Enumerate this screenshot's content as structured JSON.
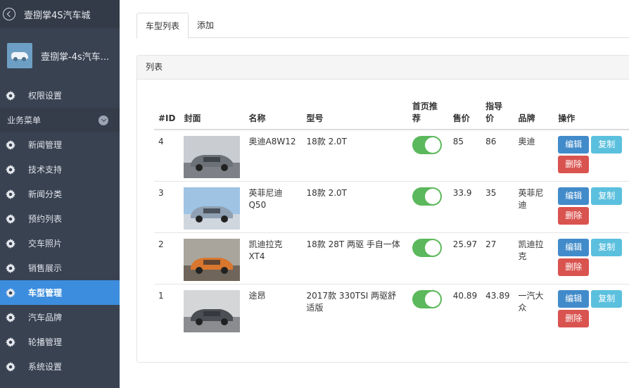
{
  "sidebar": {
    "title": "壹捌掌4S汽车城",
    "username": "壹捌掌-4s汽车...",
    "top_item": "权限设置",
    "group_label": "业务菜单",
    "items": [
      "新闻管理",
      "技术支持",
      "新闻分类",
      "预约列表",
      "交车照片",
      "销售展示",
      "车型管理",
      "汽车品牌",
      "轮播管理",
      "系统设置"
    ],
    "active_item": "车型管理"
  },
  "tabs": [
    "车型列表",
    "添加"
  ],
  "panel_title": "列表",
  "table": {
    "headers": [
      "#ID",
      "封面",
      "名称",
      "型号",
      "首页推荐",
      "售价",
      "指导价",
      "品牌",
      "操作"
    ],
    "rows": [
      {
        "id": "4",
        "name": "奥迪A8W12",
        "model": "18款 2.0T",
        "price": "85",
        "guide": "86",
        "brand": "奥迪"
      },
      {
        "id": "3",
        "name": "英菲尼迪Q50",
        "model": "18款 2.0T",
        "price": "33.9",
        "guide": "35",
        "brand": "英菲尼迪"
      },
      {
        "id": "2",
        "name": "凯迪拉克XT4",
        "model": "18款 28T 两驱 手自一体",
        "price": "25.97",
        "guide": "27",
        "brand": "凯迪拉克"
      },
      {
        "id": "1",
        "name": "途昂",
        "model": "2017款 330TSI 两驱舒适版",
        "price": "40.89",
        "guide": "43.89",
        "brand": "一汽大众"
      }
    ],
    "btn_edit": "编辑",
    "btn_copy": "复制",
    "btn_delete": "删除"
  },
  "colors": {
    "sidebar_bg": "#394251",
    "active": "#3c8dde",
    "toggle_on": "#5cb85c"
  }
}
